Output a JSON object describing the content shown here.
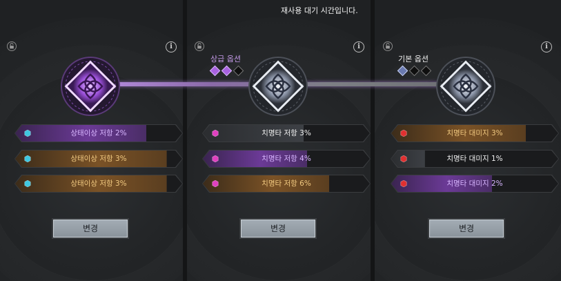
{
  "notification": "재사용 대기 시간입니다.",
  "change_label": "변경",
  "panels": [
    {
      "tier_label": "",
      "tier_dots": [],
      "emblem": "purple-rune-emblem",
      "options": [
        {
          "text": "상태이상 저항 2%",
          "gem": "cyan",
          "fill": "purple",
          "level": 0.78
        },
        {
          "text": "상태이상 저항 3%",
          "gem": "cyan",
          "fill": "orange",
          "level": 0.9
        },
        {
          "text": "상태이상 저항 3%",
          "gem": "cyan",
          "fill": "orange",
          "level": 0.9
        }
      ]
    },
    {
      "tier_label": "상급 옵션",
      "tier_dots": [
        "on",
        "on",
        "off"
      ],
      "emblem": "silver-rune-emblem",
      "options": [
        {
          "text": "치명타 저항 3%",
          "gem": "magenta",
          "fill": "gray",
          "level": 0.6
        },
        {
          "text": "치명타 저항 4%",
          "gem": "magenta",
          "fill": "purple",
          "level": 0.62
        },
        {
          "text": "치명타 저항 6%",
          "gem": "magenta",
          "fill": "orange",
          "level": 0.75
        }
      ]
    },
    {
      "tier_label": "기본 옵션",
      "tier_dots": [
        "on",
        "off",
        "off"
      ],
      "emblem": "silver-rune-emblem",
      "options": [
        {
          "text": "치명타 대미지 3%",
          "gem": "red",
          "fill": "orange",
          "level": 0.8
        },
        {
          "text": "치명타 대미지 1%",
          "gem": "red",
          "fill": "gray",
          "level": 0.2
        },
        {
          "text": "치명타 대미지 2%",
          "gem": "red",
          "fill": "purple",
          "level": 0.6
        }
      ]
    }
  ],
  "colors": {
    "cyan": "#3fc7e0",
    "magenta": "#e040c0",
    "red": "#e03030",
    "purple_glow": "#c07aff"
  }
}
